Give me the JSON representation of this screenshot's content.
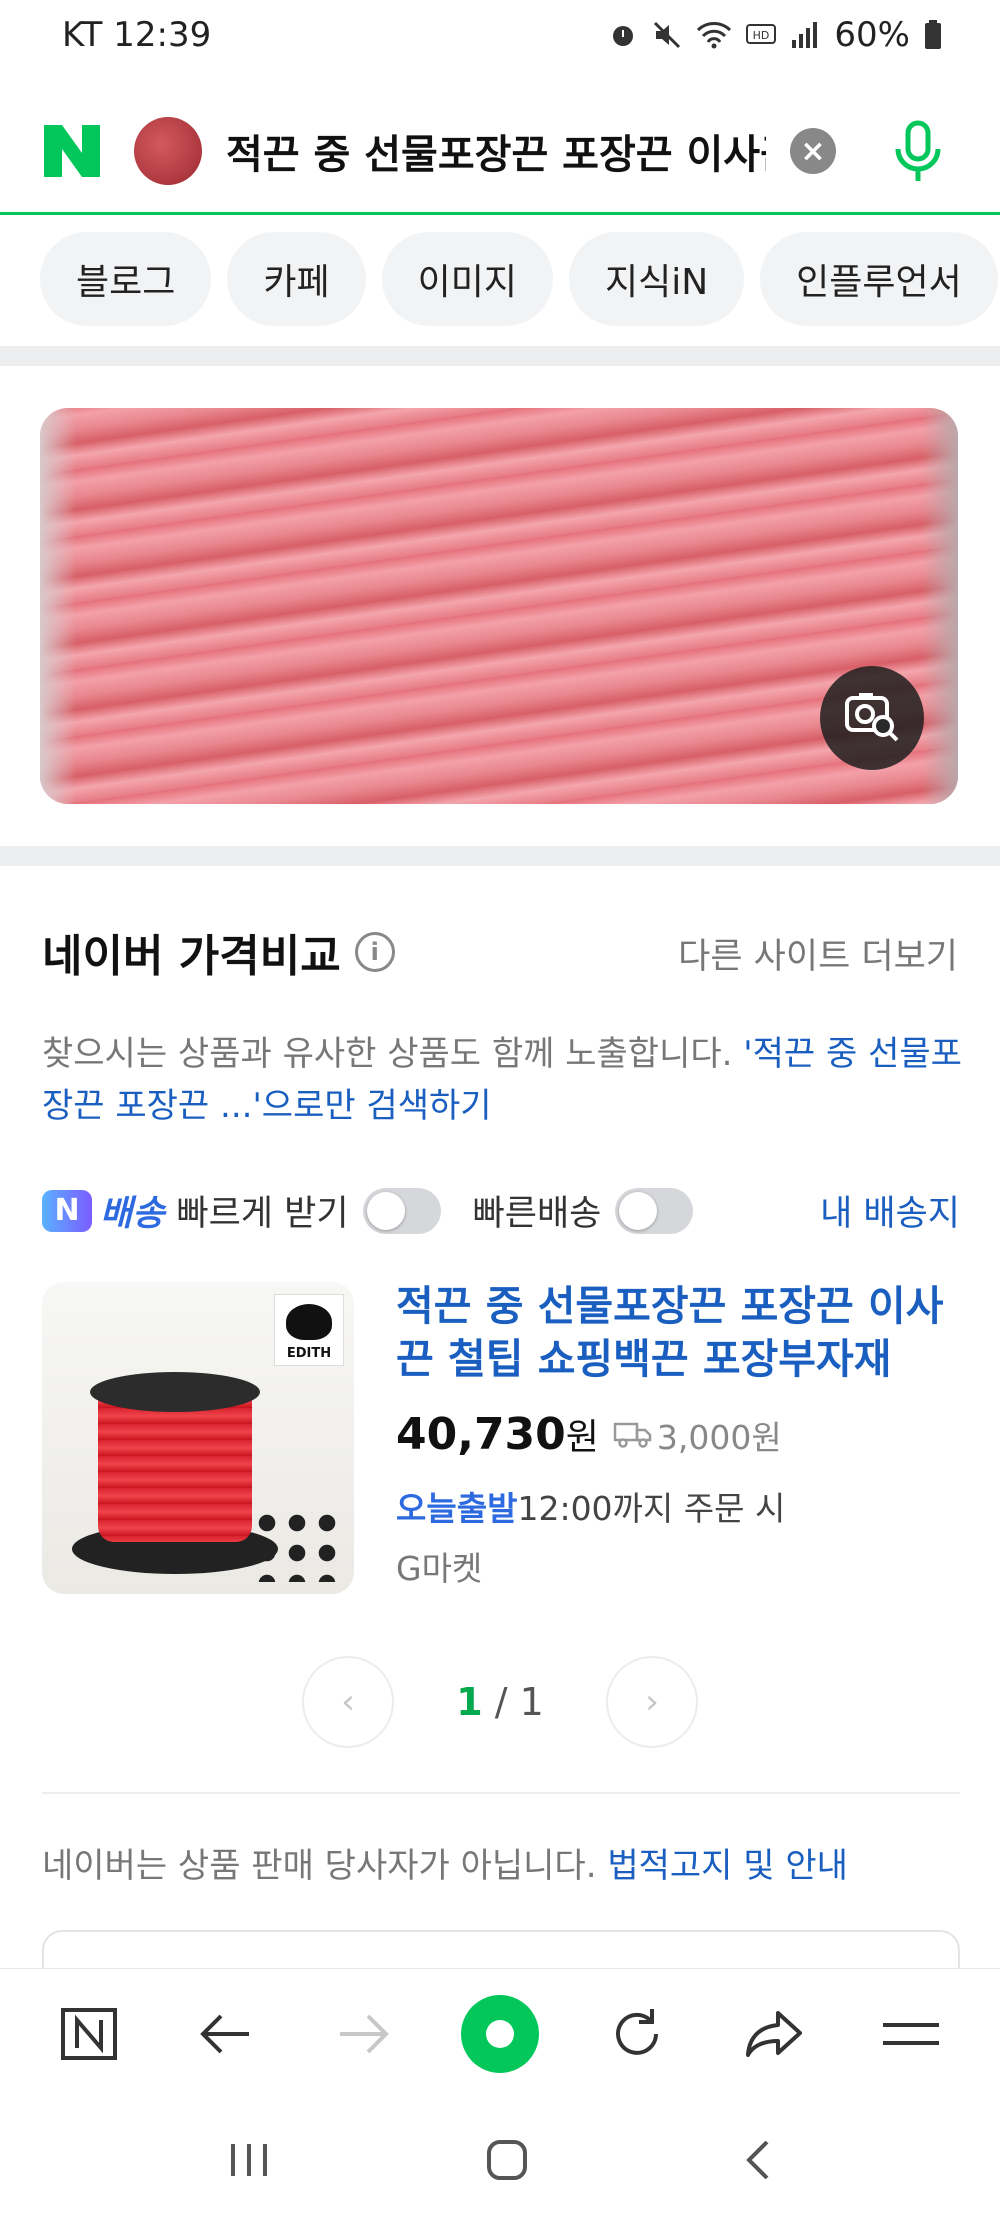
{
  "status_bar": {
    "carrier_time": "KT 12:39",
    "battery": "60%"
  },
  "search": {
    "query": "적끈 중 선물포장끈 포장끈 이사끈 철팁 쇼핑백끈 포장부자재"
  },
  "tabs": [
    "블로그",
    "카페",
    "이미지",
    "지식iN",
    "인플루언서"
  ],
  "price_compare": {
    "title": "네이버 가격비교",
    "more_sites": "다른 사이트 더보기",
    "notice_text": "찾으시는 상품과 유사한 상품도 함께 노출합니다.",
    "notice_link": "'적끈 중 선물포장끈 포장끈 ...'으로만 검색하기",
    "npay_badge": "N",
    "delivery_label": "배송",
    "fast_receive": "빠르게 받기",
    "fast_delivery": "빠른배송",
    "my_address": "내 배송지"
  },
  "product": {
    "title": "적끈 중 선물포장끈 포장끈 이사끈 철팁 쇼핑백끈 포장부자재",
    "price": "40,730",
    "won": "원",
    "shipping_fee": "3,000원",
    "dispatch_today": "오늘출발",
    "dispatch_rest": "12:00까지 주문 시",
    "seller": "G마켓",
    "brand": "EDITH"
  },
  "pagination": {
    "current": "1",
    "separator": " / ",
    "total": "1"
  },
  "disclaimer": {
    "text": "네이버는 상품 판매 당사자가 아닙니다.",
    "link": "법적고지 및 안내"
  },
  "colors": {
    "naver_green": "#03c75a",
    "link_blue": "#1a5fc0"
  }
}
